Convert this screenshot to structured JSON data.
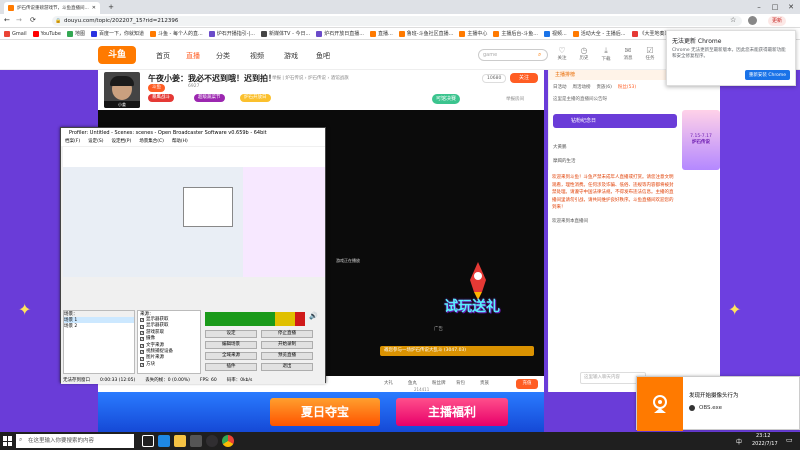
{
  "browser": {
    "tab_title": "炉石传说重磅游戏节，斗鱼直播间...",
    "url": "douyu.com/topic/202207_15?rid=212396",
    "update_label": "更新",
    "bookmarks": [
      {
        "label": "Gmail",
        "color": "#ea4335"
      },
      {
        "label": "YouTube",
        "color": "#ff0000"
      },
      {
        "label": "地图",
        "color": "#34a853"
      },
      {
        "label": "百度一下，你就知道",
        "color": "#2932e1"
      },
      {
        "label": "斗鱼 - 每个人的直...",
        "color": "#ff7a00"
      },
      {
        "label": "炉石开播指引-|...",
        "color": "#6b4bc9"
      },
      {
        "label": "新媒体TV - 今日...",
        "color": "#444"
      },
      {
        "label": "炉石开放日直播...",
        "color": "#6b4bc9"
      },
      {
        "label": "直播...",
        "color": "#ff7a00"
      },
      {
        "label": "鲁班-斗鱼社区直播...",
        "color": "#ff7a00"
      },
      {
        "label": "主播中心",
        "color": "#ff7a00"
      },
      {
        "label": "主播后台-斗鱼...",
        "color": "#ff7a00"
      },
      {
        "label": "视频...",
        "color": "#1a73e8"
      },
      {
        "label": "活动大全 - 主播后...",
        "color": "#ff7a00"
      },
      {
        "label": "《大圣地奏》音乐...",
        "color": "#e53935"
      },
      {
        "label": "其他收藏夹",
        "color": "#fbc02d"
      }
    ]
  },
  "chrome_popup": {
    "title": "无法更新 Chrome",
    "body": "Chrome 无法更新至最新版本，因此您未能获得最新功能和安全修复程序。",
    "button": "重新安装 Chrome"
  },
  "site": {
    "logo": "斗鱼",
    "nav": [
      "首页",
      "直播",
      "分类",
      "视频",
      "游戏",
      "鱼吧"
    ],
    "active_nav_index": 1,
    "search_placeholder": "game",
    "header_icons": [
      "关注",
      "历史",
      "下载",
      "消息",
      "任务",
      "付费",
      "签到"
    ],
    "rank": "主播排榜",
    "top_right": "直播日历"
  },
  "room": {
    "title": "午夜小姜：我必不迟到哦！迟到拍！",
    "streamer_tag": "小姜",
    "meta": "举报  |  炉石传说 › 炉石传说 › 酒馆战旗",
    "level": "6927",
    "fans_label": "10680",
    "follow_label": "关注",
    "badges": [
      {
        "label": "斗鱼",
        "color": "#ff5d23"
      },
      {
        "label": "暴鹰战斗",
        "color": "#e53935"
      },
      {
        "label": "超级蔬菜节",
        "color": "#9c27b0"
      },
      {
        "label": "炉石开放日",
        "color": "#fbc02d"
      }
    ],
    "sub_label": "可馆决赛",
    "report_label": "举报房间",
    "gift_row": [
      "大礼",
      "鱼丸",
      "粉丝牌",
      "背包",
      "贵族"
    ],
    "gift_count": "214411",
    "recharge": "充值"
  },
  "right_panel": {
    "tabs": [
      "日活动",
      "周活动榜",
      "贵族(6)",
      "粉丝(53)"
    ],
    "notice": "这里是主播的直播间公告呀",
    "cards": [
      "钻粉纪念日",
      "大黄鹏",
      "摩羯的生活"
    ],
    "chat_text": "欢迎来到斗鱼！斗鱼严禁未成年人直播或打赏。请您注意文明观看，理性消费。任何涉及诈骗、低俗、违规等内容都将被封禁处理。请遵守中国法律法规，不得发布违法信息。主播的直播间里请勿引战，请共同维护良好秩序。斗鱼直播间欢迎您的到来！",
    "welcome": "欢迎来到本直播间",
    "input_placeholder": "这里输入聊天内容",
    "send": "发送",
    "promo_date": "7.15-7.17",
    "promo_title": "炉石传说"
  },
  "banner": {
    "left": "夏日夺宝",
    "right": "主播福利"
  },
  "video": {
    "overlay_small": "游戏正在播放",
    "promo": "试玩送礼",
    "notice_bar": "邀您参与一场炉石传说大乱斗 (3047.03)",
    "ad": "广告"
  },
  "obs": {
    "title": "Profiler: Untitled - Scenes: scenes - Open Broadcaster Software v0.659b - 64bit",
    "menu": [
      "档案(F)",
      "设定(S)",
      "设定档(P)",
      "场景集合(C)",
      "帮助(H)"
    ],
    "scenes_label": "场景：",
    "scenes": [
      "场景 1",
      "场景 2"
    ],
    "sources_label": "来源：",
    "sources": [
      "显示器获取",
      "显示器获取",
      "游戏获取",
      "摄像",
      "文字来源",
      "视频捕捉设备",
      "图片来源",
      "方块"
    ],
    "buttons": [
      "设定",
      "停止直播",
      "编辑场景",
      "开始录制",
      "全域来源",
      "预览直播",
      "插件",
      "退出"
    ],
    "status": [
      "无法存到窗口",
      "0:00:33 (12:05)",
      "丢失的帧：0 (0.00%)",
      "FPS: 60",
      "码率：0kb/s"
    ]
  },
  "toast": {
    "title": "发现开始摄像头行为",
    "body": "OBS.exe"
  },
  "taskbar": {
    "search_placeholder": "在这里输入你要搜索的内容",
    "time": "23:12",
    "date": "2022/7/17",
    "lang": "中"
  }
}
